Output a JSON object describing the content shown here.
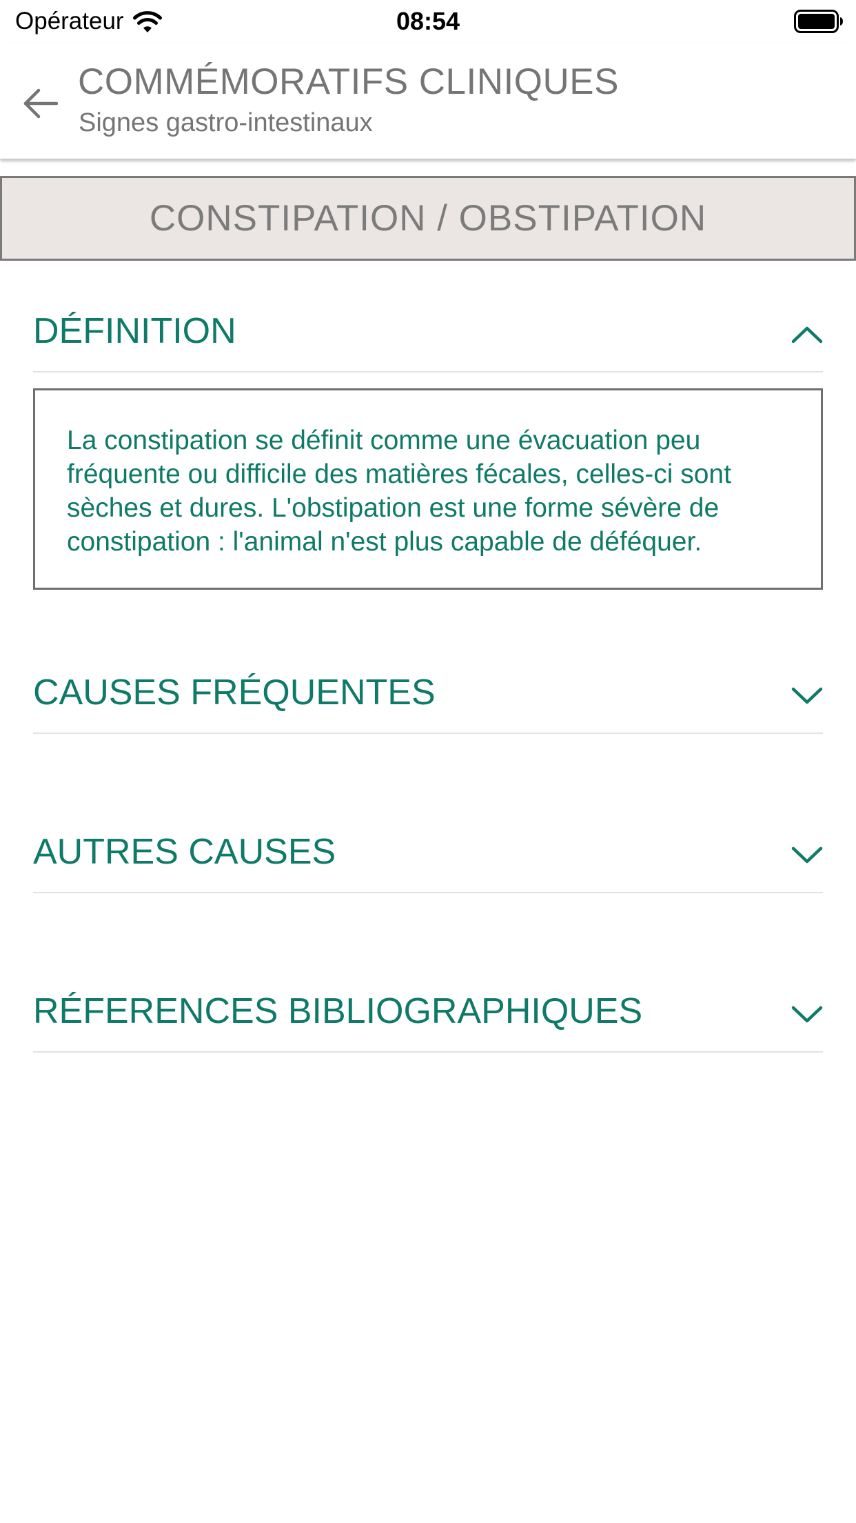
{
  "status_bar": {
    "carrier": "Opérateur",
    "time": "08:54",
    "wifi_icon": "wifi-icon",
    "battery_icon": "battery-full-icon"
  },
  "app_bar": {
    "back_icon": "arrow-left-icon",
    "title": "COMMÉMORATIFS CLINIQUES",
    "subtitle": "Signes gastro-intestinaux"
  },
  "section": {
    "title": "CONSTIPATION / OBSTIPATION"
  },
  "colors": {
    "accent": "#0f7a67",
    "header_text": "#757575",
    "section_bg": "#ebe6e4",
    "divider": "#e2e2e2"
  },
  "accordion": {
    "items": [
      {
        "title": "DÉFINITION",
        "expanded": true,
        "icon": "chevron-up-icon",
        "content": "La constipation se définit comme une évacuation peu fréquente ou difficile des matières fécales, celles-ci sont sèches et dures. L'obstipation est une forme sévère de constipation : l'animal n'est plus capable de déféquer."
      },
      {
        "title": "CAUSES FRÉQUENTES",
        "expanded": false,
        "icon": "chevron-down-icon"
      },
      {
        "title": "AUTRES CAUSES",
        "expanded": false,
        "icon": "chevron-down-icon"
      },
      {
        "title": "RÉFERENCES BIBLIOGRAPHIQUES",
        "expanded": false,
        "icon": "chevron-down-icon"
      }
    ]
  }
}
